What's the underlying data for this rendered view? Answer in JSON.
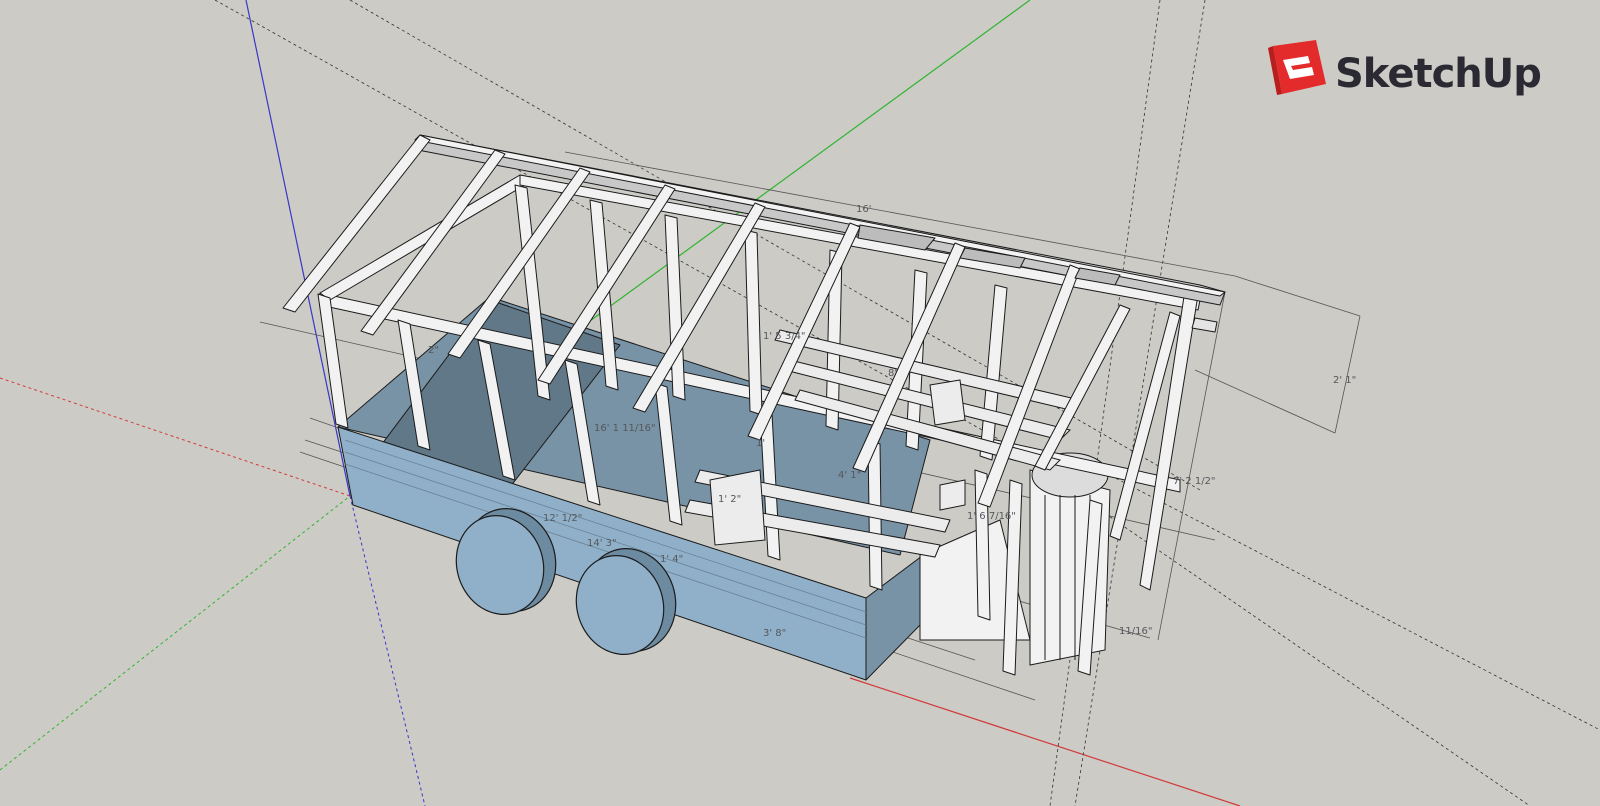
{
  "app": {
    "logo_text": "SketchUp",
    "logo_color": "#e32b2b"
  },
  "dimensions": {
    "overall_length": "16'",
    "overall_height": "7' 2 1/2\"",
    "roof_rise": "2' 1\"",
    "inner_length": "16' 1 11/16\"",
    "bed_length": "12' 1/2\"",
    "trailer_length": "14' 3\"",
    "tongue_offset": "1' 4\"",
    "rear_section": "3' 8\"",
    "loft_spacing": "1' 5 3/4\"",
    "partial_a": "1' 6 7/16\"",
    "partial_b": "4' 1\"",
    "partial_c": "1'",
    "partial_d": "11/16\"",
    "partial_e": "8'",
    "partial_f": "2\"",
    "partial_g": "1' 2\""
  },
  "colors": {
    "background": "#cccbc6",
    "axis_red": "#d23a3a",
    "axis_green": "#2fb52f",
    "axis_blue": "#3838c8",
    "trailer_blue": "#8fb0c8",
    "framing": "#f2f2f2",
    "edges": "#1b1b1b"
  }
}
